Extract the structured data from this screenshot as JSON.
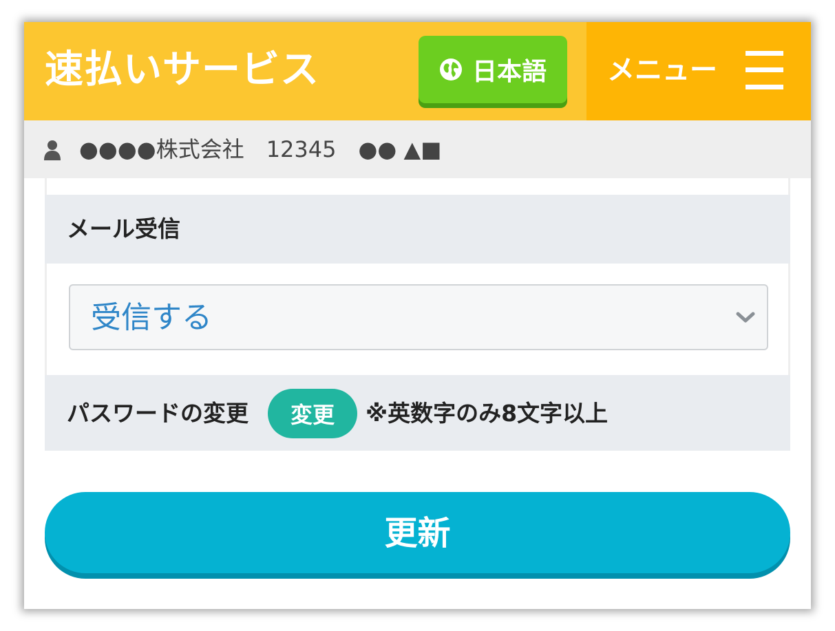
{
  "header": {
    "brand": "速払いサービス",
    "language_button": {
      "label": "日本語",
      "icon": "globe-icon"
    },
    "menu": {
      "label": "メニュー",
      "icon": "hamburger-icon"
    }
  },
  "user_bar": {
    "icon": "user-icon",
    "text": "●●●●株式会社　12345　●● ▲■"
  },
  "mail_section": {
    "title": "メール受信",
    "select": {
      "value": "受信する",
      "icon": "chevron-down-icon"
    }
  },
  "password_section": {
    "label": "パスワードの変更",
    "button_label": "変更",
    "note": "※英数字のみ8文字以上"
  },
  "update_button": {
    "label": "更新"
  },
  "colors": {
    "header_yellow": "#fcc630",
    "menu_orange": "#feb505",
    "language_green": "#6cce20",
    "select_text_blue": "#2f86c8",
    "change_button_teal": "#21b6a0",
    "update_button_cyan": "#05b2d2"
  }
}
